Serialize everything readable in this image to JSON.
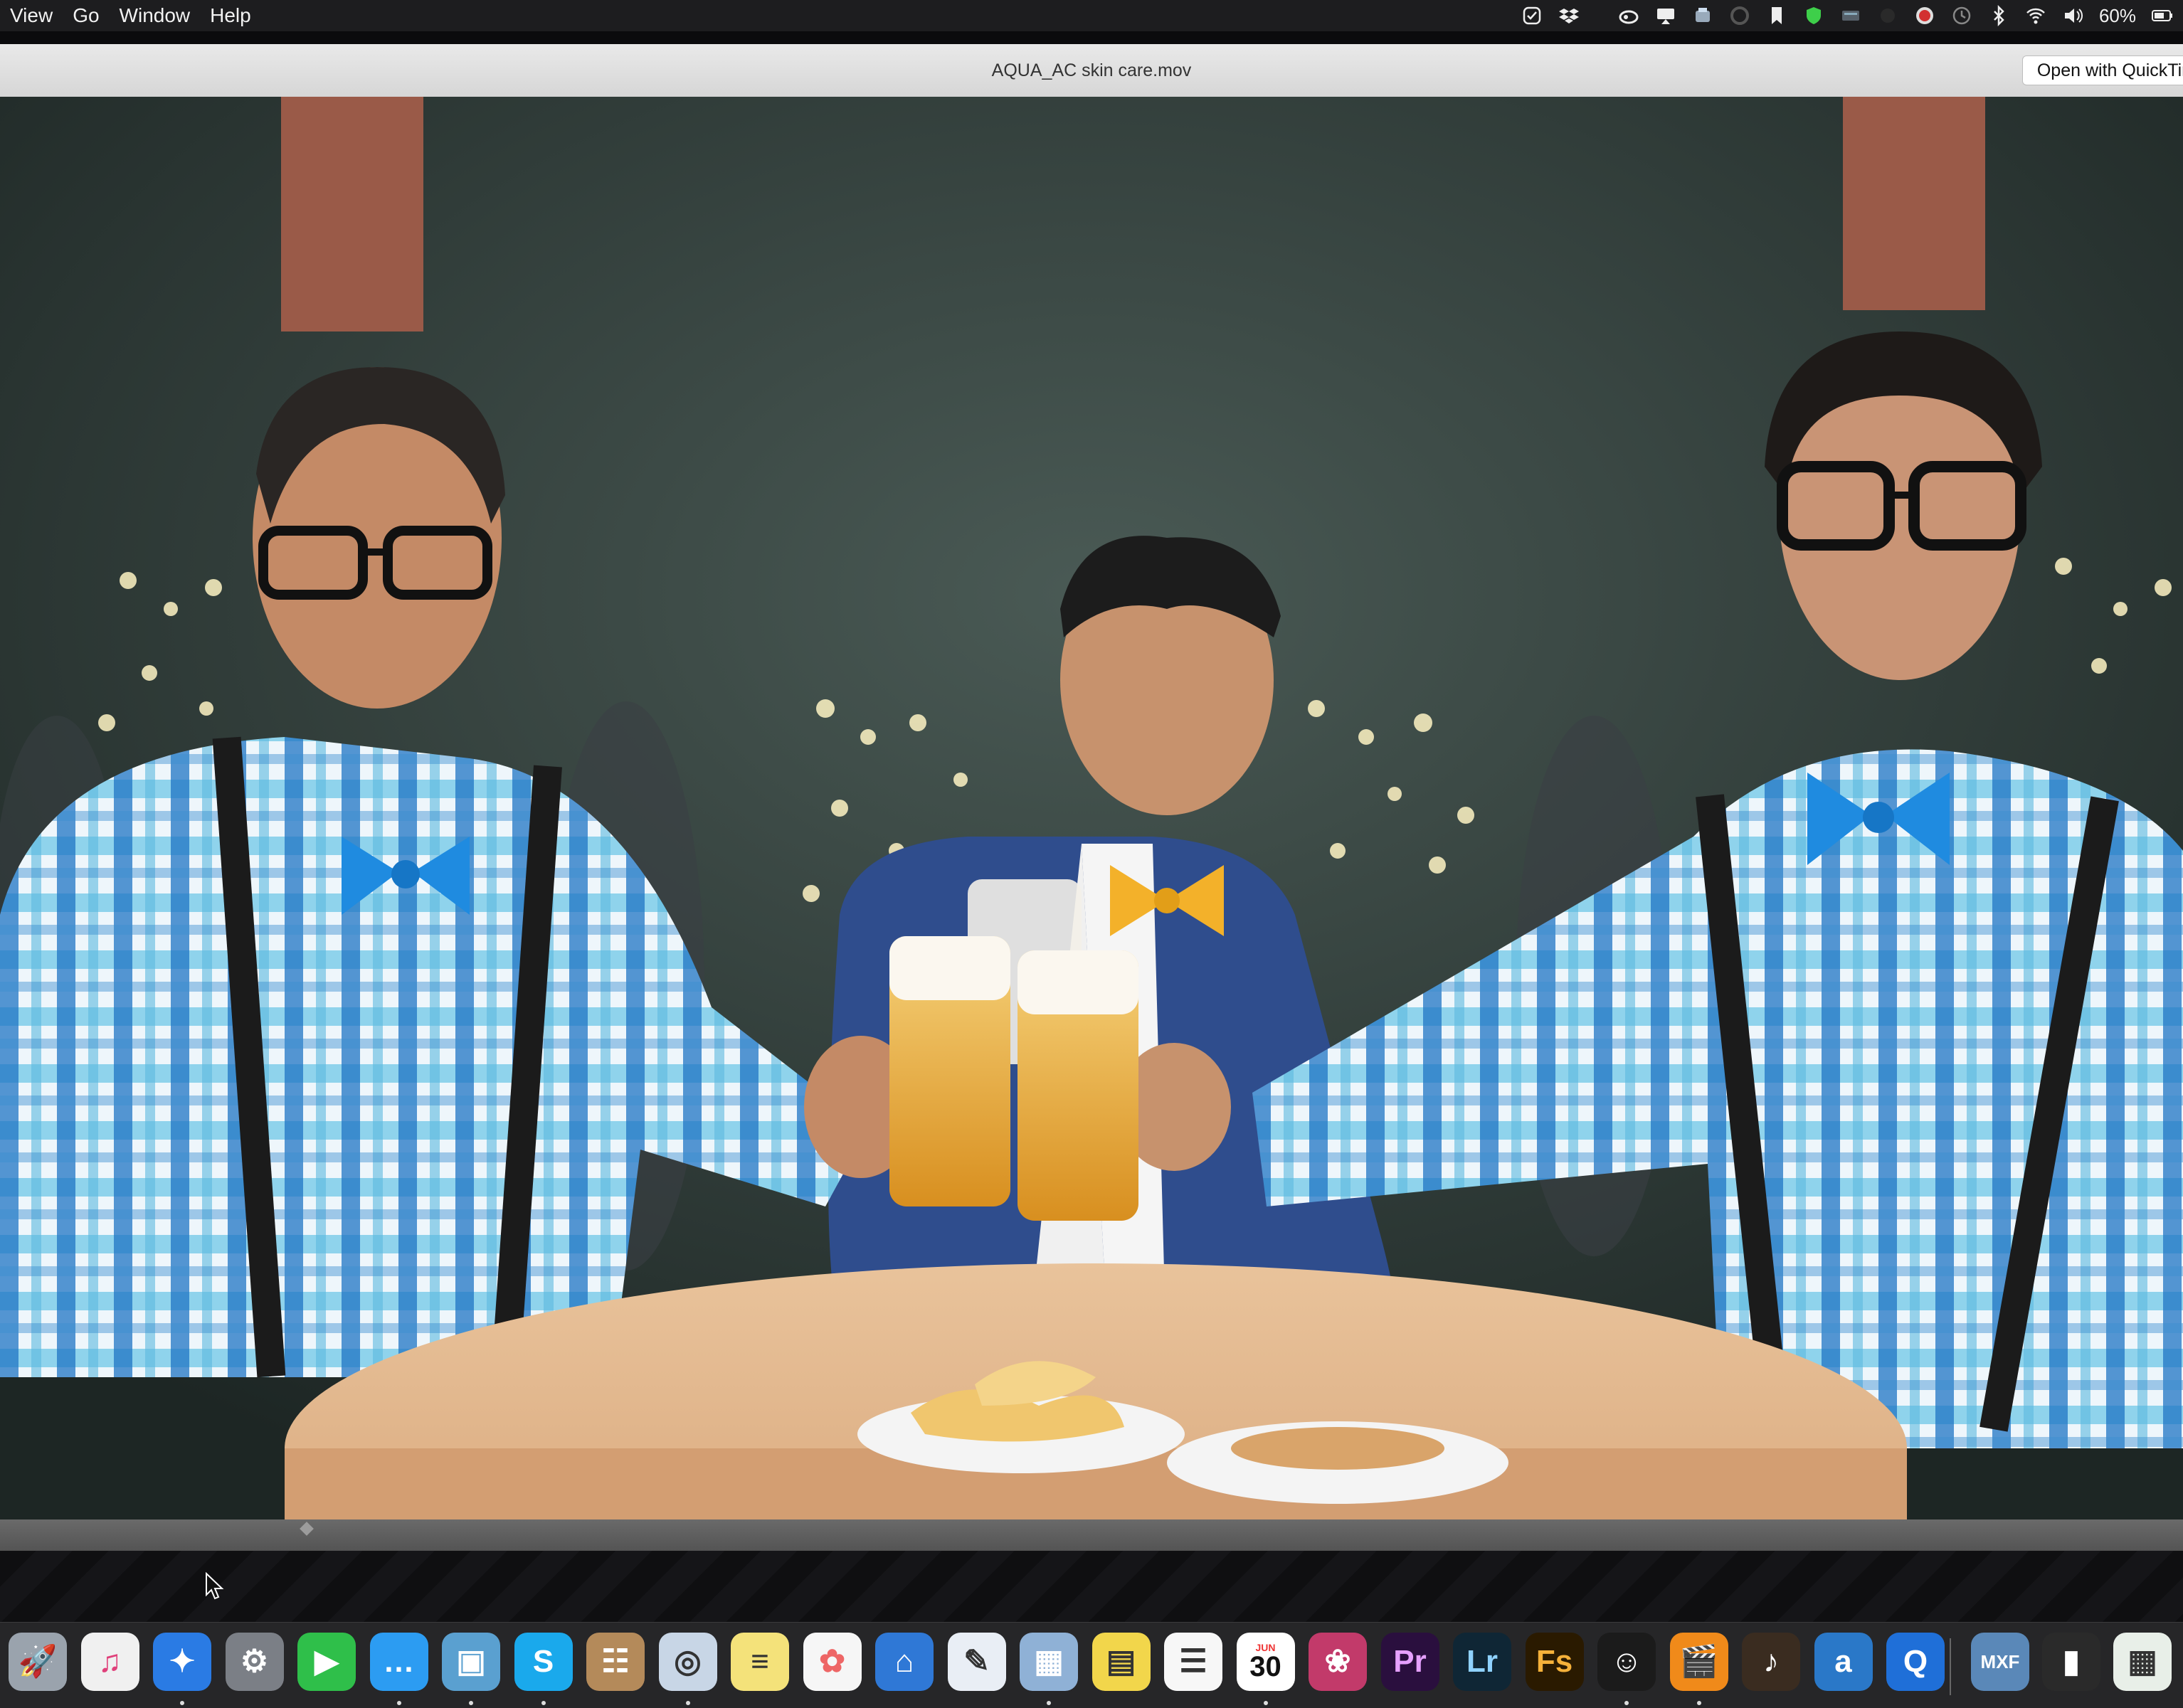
{
  "menubar": {
    "menus": [
      "View",
      "Go",
      "Window",
      "Help"
    ],
    "battery_percent": "60%",
    "status_icons": [
      "tasks-icon",
      "dropbox-icon",
      "creative-cloud-icon",
      "airplay-icon",
      "sync-icon",
      "grammarly-icon",
      "bookmark-icon",
      "shield-icon",
      "display-icon",
      "record-icon",
      "time-machine-icon",
      "bluetooth-icon",
      "wifi-icon",
      "volume-icon",
      "battery-icon"
    ]
  },
  "window": {
    "title": "AQUA_AC skin care.mov",
    "open_with_label": "Open with QuickTim"
  },
  "dock": {
    "apps": [
      {
        "name": "launchpad",
        "icon": "rocket-icon",
        "bg": "#9aa3ad"
      },
      {
        "name": "itunes",
        "icon": "music-note-icon",
        "bg": "#f0f0f0"
      },
      {
        "name": "safari",
        "icon": "compass-icon",
        "bg": "#2a7be4"
      },
      {
        "name": "system-preferences",
        "icon": "gear-icon",
        "bg": "#7b7f86"
      },
      {
        "name": "facetime",
        "icon": "video-camera-icon",
        "bg": "#2fbf4a"
      },
      {
        "name": "messages",
        "icon": "speech-bubble-icon",
        "bg": "#2c9cf2"
      },
      {
        "name": "preview",
        "icon": "photo-icon",
        "bg": "#5aa0d0"
      },
      {
        "name": "skype",
        "icon": "skype-icon",
        "bg": "#1aa9ec"
      },
      {
        "name": "contacts",
        "icon": "contacts-icon",
        "bg": "#b48a5a"
      },
      {
        "name": "image-capture",
        "icon": "image-capture-icon",
        "bg": "#c8d6e6"
      },
      {
        "name": "notes",
        "icon": "notepad-icon",
        "bg": "#f4e27a"
      },
      {
        "name": "photos",
        "icon": "photos-flower-icon",
        "bg": "#f6f6f6"
      },
      {
        "name": "keynote",
        "icon": "keynote-icon",
        "bg": "#2f78d6"
      },
      {
        "name": "textedit",
        "icon": "textedit-icon",
        "bg": "#e9eef5"
      },
      {
        "name": "photo-booth",
        "icon": "photo-browser-icon",
        "bg": "#8fb1d6"
      },
      {
        "name": "stickies",
        "icon": "stickies-icon",
        "bg": "#f2d64b"
      },
      {
        "name": "reminders",
        "icon": "list-icon",
        "bg": "#f7f7f7"
      },
      {
        "name": "calendar",
        "icon": "calendar-icon",
        "bg": "#ffffff"
      },
      {
        "name": "davinci-resolve",
        "icon": "resolve-icon",
        "bg": "#c23a6a"
      },
      {
        "name": "premiere-pro",
        "icon": "premiere-icon",
        "bg": "#2a0f3e"
      },
      {
        "name": "lightroom",
        "icon": "lightroom-icon",
        "bg": "#0f2635"
      },
      {
        "name": "fuse",
        "icon": "fuse-icon",
        "bg": "#2a1a00"
      },
      {
        "name": "lynda",
        "icon": "lynda-icon",
        "bg": "#1b1b1b"
      },
      {
        "name": "final-cut",
        "icon": "clapper-icon",
        "bg": "#f08a1a"
      },
      {
        "name": "garageband",
        "icon": "guitar-icon",
        "bg": "#3a2c20"
      },
      {
        "name": "amazon",
        "icon": "amazon-icon",
        "bg": "#2a78c8"
      },
      {
        "name": "quicktime",
        "icon": "quicktime-icon",
        "bg": "#1f6fd8"
      },
      {
        "name": "mxf-app",
        "icon": "mxf-icon",
        "bg": "#5a88b8"
      },
      {
        "name": "black-document",
        "icon": "document-icon",
        "bg": "#2a2a2a"
      },
      {
        "name": "spreadsheet-document",
        "icon": "spreadsheet-icon",
        "bg": "#e8efe8"
      }
    ],
    "labels": {
      "skype": "S",
      "premiere-pro": "Pr",
      "lightroom": "Lr",
      "fuse": "Fs",
      "calendar_month": "JUN",
      "calendar_day": "30",
      "amazon": "a",
      "mxf-app": "MXF"
    }
  }
}
